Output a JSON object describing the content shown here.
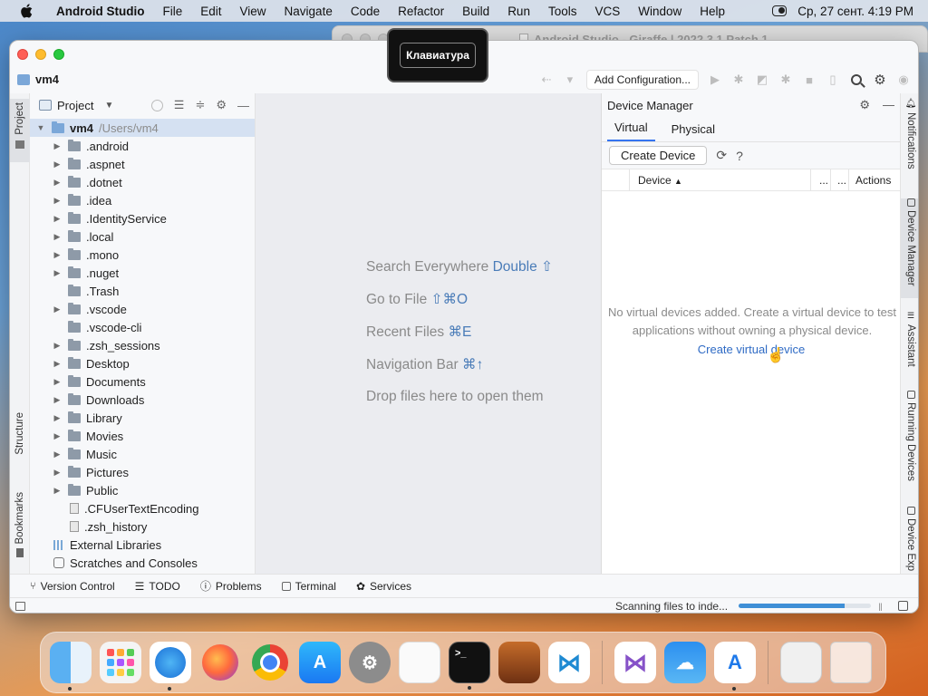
{
  "menubar": {
    "app_name": "Android Studio",
    "items": [
      "File",
      "Edit",
      "View",
      "Navigate",
      "Code",
      "Refactor",
      "Build",
      "Run",
      "Tools",
      "VCS",
      "Window",
      "Help"
    ],
    "datetime": "Ср, 27 сент.  4:19 PM"
  },
  "bg_window": {
    "title": "Android Studio - Giraffe | 2022.3.1 Patch 1"
  },
  "keyboard_overlay": {
    "label": "Клавиатура"
  },
  "window": {
    "project_name": "vm4",
    "add_configuration": "Add Configuration..."
  },
  "left_stripe": {
    "project": "Project",
    "structure": "Structure",
    "bookmarks": "Bookmarks"
  },
  "project_panel": {
    "title": "Project",
    "root": {
      "name": "vm4",
      "path": "/Users/vm4"
    },
    "items": [
      {
        "label": ".android",
        "type": "folder",
        "expandable": true
      },
      {
        "label": ".aspnet",
        "type": "folder",
        "expandable": true
      },
      {
        "label": ".dotnet",
        "type": "folder",
        "expandable": true
      },
      {
        "label": ".idea",
        "type": "folder",
        "expandable": true
      },
      {
        "label": ".IdentityService",
        "type": "folder",
        "expandable": true
      },
      {
        "label": ".local",
        "type": "folder",
        "expandable": true
      },
      {
        "label": ".mono",
        "type": "folder",
        "expandable": true
      },
      {
        "label": ".nuget",
        "type": "folder",
        "expandable": true
      },
      {
        "label": ".Trash",
        "type": "folder",
        "expandable": false
      },
      {
        "label": ".vscode",
        "type": "folder",
        "expandable": true
      },
      {
        "label": ".vscode-cli",
        "type": "folder",
        "expandable": false
      },
      {
        "label": ".zsh_sessions",
        "type": "folder",
        "expandable": true
      },
      {
        "label": "Desktop",
        "type": "folder",
        "expandable": true
      },
      {
        "label": "Documents",
        "type": "folder",
        "expandable": true
      },
      {
        "label": "Downloads",
        "type": "folder",
        "expandable": true
      },
      {
        "label": "Library",
        "type": "folder",
        "expandable": true
      },
      {
        "label": "Movies",
        "type": "folder",
        "expandable": true
      },
      {
        "label": "Music",
        "type": "folder",
        "expandable": true
      },
      {
        "label": "Pictures",
        "type": "folder",
        "expandable": true
      },
      {
        "label": "Public",
        "type": "folder",
        "expandable": true
      },
      {
        "label": ".CFUserTextEncoding",
        "type": "file",
        "expandable": false
      },
      {
        "label": ".zsh_history",
        "type": "file",
        "expandable": false
      }
    ],
    "external_libraries": "External Libraries",
    "scratches": "Scratches and Consoles"
  },
  "editor_hints": [
    {
      "text": "Search Everywhere",
      "key": "Double ⇧"
    },
    {
      "text": "Go to File",
      "key": "⇧⌘O"
    },
    {
      "text": "Recent Files",
      "key": "⌘E"
    },
    {
      "text": "Navigation Bar",
      "key": "⌘↑"
    },
    {
      "text": "Drop files here to open them",
      "key": ""
    }
  ],
  "device_manager": {
    "title": "Device Manager",
    "tabs": [
      "Virtual",
      "Physical"
    ],
    "create_button": "Create Device",
    "columns": {
      "device": "Device",
      "dots1": "...",
      "dots2": "...",
      "actions": "Actions"
    },
    "empty_line1": "No virtual devices added. Create a virtual device to test",
    "empty_line2": "applications without owning a physical device.",
    "create_link": "Create virtual device"
  },
  "right_stripe": [
    "Notifications",
    "Device Manager",
    "Assistant",
    "Running Devices",
    "Device Exp"
  ],
  "bottom_tools": [
    "Version Control",
    "TODO",
    "Problems",
    "Terminal",
    "Services"
  ],
  "status": {
    "text": "Scanning files to inde...",
    "progress_fraction": 0.8
  },
  "colors": {
    "accent": "#3574f0",
    "link": "#2f6bc5",
    "selection": "#d5e1f2"
  }
}
